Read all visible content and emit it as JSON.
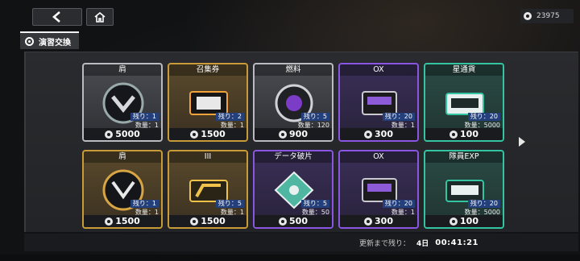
{
  "header": {
    "back_icon": "chevron-left-icon",
    "home_icon": "home-icon",
    "currency": {
      "icon": "coin-icon",
      "value": "23975"
    }
  },
  "tab": {
    "label": "演習交換",
    "icon": "target-icon"
  },
  "items": [
    {
      "name": "肩",
      "rarity": "silver",
      "remain": "残り：1",
      "qty": "数量：1",
      "price": "5000"
    },
    {
      "name": "召集券",
      "rarity": "gold",
      "remain": "残り：2",
      "qty": "数量：1",
      "price": "1500"
    },
    {
      "name": "燃料",
      "rarity": "silver",
      "remain": "残り：5",
      "qty": "数量：120",
      "price": "900"
    },
    {
      "name": "OX",
      "rarity": "purple",
      "remain": "残り：20",
      "qty": "数量：1",
      "price": "300"
    },
    {
      "name": "星通貨",
      "rarity": "green",
      "remain": "残り：20",
      "qty": "数量：5000",
      "price": "100"
    },
    {
      "name": "肩",
      "rarity": "gold",
      "remain": "残り：1",
      "qty": "数量：1",
      "price": "1500"
    },
    {
      "name": "III",
      "rarity": "gold",
      "remain": "残り：5",
      "qty": "数量：1",
      "price": "1500"
    },
    {
      "name": "データ破片",
      "rarity": "purple",
      "remain": "残り：5",
      "qty": "数量：50",
      "price": "500"
    },
    {
      "name": "OX",
      "rarity": "purple",
      "remain": "残り：20",
      "qty": "数量：1",
      "price": "300"
    },
    {
      "name": "隊員EXP",
      "rarity": "green",
      "remain": "残り：20",
      "qty": "数量：5000",
      "price": "100"
    }
  ],
  "footer": {
    "refresh_label": "更新まで残り：",
    "days": "4日",
    "time": "00:41:21"
  },
  "colors": {
    "silver": "#b9bbc0",
    "gold": "#c99a38",
    "purple": "#8a55e0",
    "green": "#35c4a2"
  }
}
